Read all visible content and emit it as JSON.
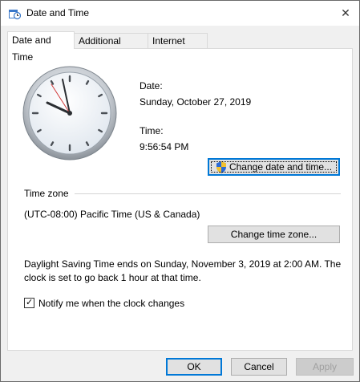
{
  "window": {
    "title": "Date and Time",
    "close_glyph": "✕"
  },
  "tabs": [
    {
      "label": "Date and Time",
      "active": true
    },
    {
      "label": "Additional Clocks",
      "active": false
    },
    {
      "label": "Internet Time",
      "active": false
    }
  ],
  "date": {
    "label": "Date:",
    "value": "Sunday, October 27, 2019"
  },
  "time": {
    "label": "Time:",
    "value": "9:56:54 PM"
  },
  "change_date_button": "Change date and time...",
  "time_zone": {
    "section_label": "Time zone",
    "value": "(UTC-08:00) Pacific Time (US & Canada)",
    "button": "Change time zone..."
  },
  "dst": {
    "line1": "Daylight Saving Time ends on Sunday, November 3, 2019 at 2:00 AM. The",
    "line2": "clock is set to go back 1 hour at that time."
  },
  "notify": {
    "label": "Notify me when the clock changes",
    "checked": true
  },
  "footer": {
    "ok": "OK",
    "cancel": "Cancel",
    "apply": "Apply"
  },
  "colors": {
    "accent": "#0078d7",
    "panel": "#ffffff",
    "chrome": "#f0f0f0"
  }
}
